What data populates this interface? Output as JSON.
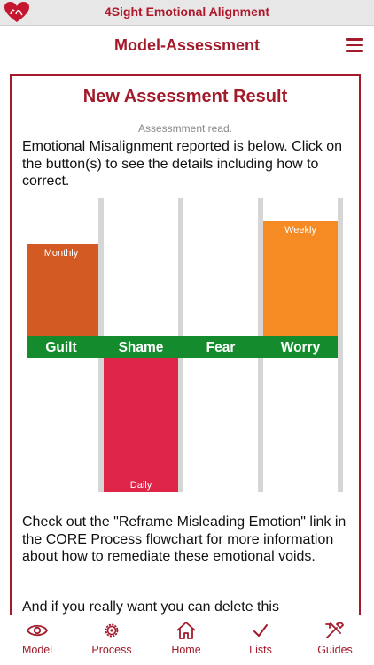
{
  "app": {
    "title": "4Sight Emotional Alignment",
    "brand_color": "#a31a2a"
  },
  "nav": {
    "title": "Model-Assessment",
    "menu_icon": "hamburger-icon"
  },
  "card": {
    "title": "New Assessment Result",
    "status": "Assessmment read.",
    "intro": "Emotional Misalignment reported is below. Click on the button(s) to see the details including how to correct.",
    "followup": "Check out the \"Reframe Misleading Emotion\" link in the CORE Process flowchart for more information about how to remediate these emotional voids.",
    "delete_note": "And if you really want you can delete this"
  },
  "chart_data": {
    "type": "bar",
    "categories": [
      "Guilt",
      "Shame",
      "Fear",
      "Worry"
    ],
    "series": [
      {
        "values": [
          2,
          -3,
          0,
          2.5
        ]
      }
    ],
    "data_labels": [
      "Monthly",
      "Daily",
      "",
      "Weekly"
    ],
    "ylim": [
      -3,
      3
    ],
    "colors": {
      "Guilt": "#d35a23",
      "Shame": "#de2547",
      "Fear": "#cccccc",
      "Worry": "#f68b24",
      "label_band": "#148c2e",
      "divider": "#d6d6d6"
    },
    "grid": false
  },
  "tabs": [
    {
      "label": "Model",
      "icon": "eye-icon"
    },
    {
      "label": "Process",
      "icon": "gear-icon"
    },
    {
      "label": "Home",
      "icon": "home-icon"
    },
    {
      "label": "Lists",
      "icon": "checkmark-icon"
    },
    {
      "label": "Guides",
      "icon": "tools-icon"
    }
  ]
}
